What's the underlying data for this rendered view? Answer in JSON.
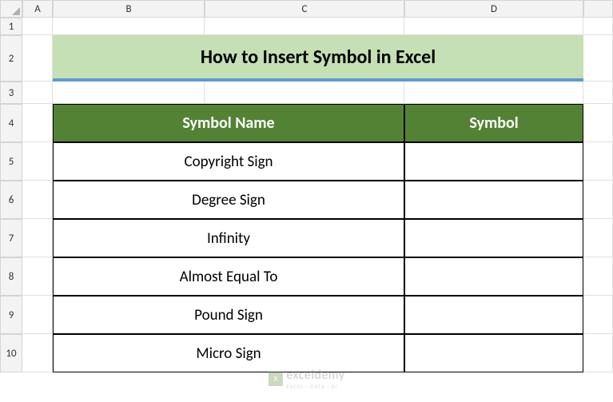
{
  "columns": [
    "A",
    "B",
    "C",
    "D",
    ""
  ],
  "rows": [
    "1",
    "2",
    "3",
    "4",
    "5",
    "6",
    "7",
    "8",
    "9",
    "10"
  ],
  "title": "How to Insert Symbol in Excel",
  "table": {
    "headers": [
      "Symbol Name",
      "Symbol"
    ],
    "rows": [
      {
        "name": "Copyright Sign",
        "symbol": ""
      },
      {
        "name": "Degree Sign",
        "symbol": ""
      },
      {
        "name": "Infinity",
        "symbol": ""
      },
      {
        "name": "Almost Equal To",
        "symbol": ""
      },
      {
        "name": "Pound Sign",
        "symbol": ""
      },
      {
        "name": "Micro Sign",
        "symbol": ""
      }
    ]
  },
  "watermark": {
    "name": "exceldemy",
    "tagline": "EXCEL · DATA · BI"
  }
}
